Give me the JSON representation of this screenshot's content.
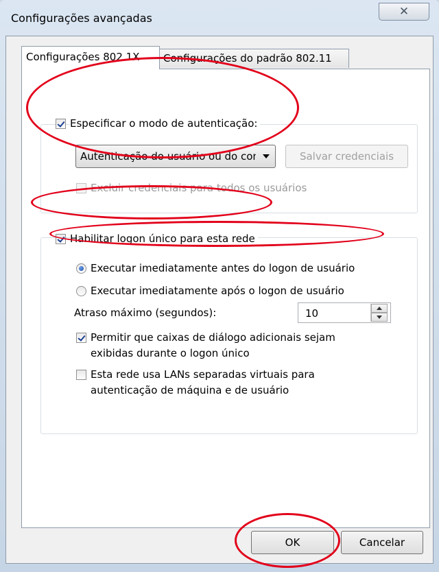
{
  "window": {
    "title": "Configurações avançadas",
    "close_glyph": "✕"
  },
  "tabs": [
    {
      "label": "Configurações 802.1X",
      "active": true
    },
    {
      "label": "Configurações do padrão 802.11",
      "active": false
    }
  ],
  "auth_group": {
    "specify_mode_label": "Especificar o modo de autenticação:",
    "specify_mode_checked": true,
    "auth_mode_value": "Autenticação do usuário ou do computador",
    "save_credentials_label": "Salvar credenciais",
    "delete_credentials_label": "Excluir credenciais para todos os usuários",
    "delete_credentials_checked": false
  },
  "sso_group": {
    "enable_sso_label": "Habilitar logon único para esta rede",
    "enable_sso_checked": true,
    "radio_before_label": "Executar imediatamente antes do logon de usuário",
    "radio_after_label": "Executar imediatamente após o logon de usuário",
    "selected_radio": "before",
    "max_delay_label": "Atraso máximo (segundos):",
    "max_delay_value": "10",
    "allow_dialogs_label_line1": "Permitir que caixas de diálogo adicionais sejam",
    "allow_dialogs_label_line2": "exibidas durante o logon único",
    "allow_dialogs_checked": true,
    "separate_vlans_label_line1": "Esta rede usa LANs separadas virtuais para",
    "separate_vlans_label_line2": "autenticação de máquina e de usuário",
    "separate_vlans_checked": false
  },
  "footer": {
    "ok_label": "OK",
    "cancel_label": "Cancelar"
  },
  "annotation_color": "#e2001a"
}
